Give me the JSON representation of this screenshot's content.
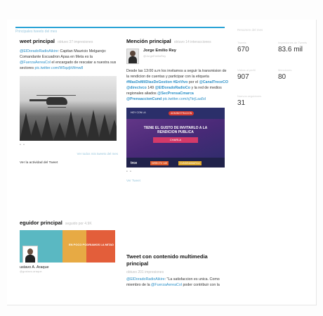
{
  "header": {
    "bar_label": "Principales tweets del mes",
    "accent_color": "#2aa3d6"
  },
  "top_tweet": {
    "title": "weet principal",
    "subtitle": "obtuvo 37 impresiones",
    "text_parts": [
      {
        "t": "@ElDoradoRadioAikire",
        "k": "lnk"
      },
      {
        "t": ": Capitan Mauricio Melgarejo: Comandante Escuadron Apaa en Meta es la ",
        "k": ""
      },
      {
        "t": "@FuerzaAereaCol",
        "k": "lnk"
      },
      {
        "t": " el encargado de rescatar a nuestra sus sectores ",
        "k": ""
      },
      {
        "t": "pic.twitter.com/W5qzjbWmw8",
        "k": "lnk"
      }
    ],
    "dots": "• •",
    "link": "Ver todos mis tweets del mes",
    "view_all": "Ver la actividad del Tweet"
  },
  "top_follower": {
    "title": "eguidor principal",
    "subtitle": "seguido por 4.9K",
    "banner_text": "EN POCO PODRIAMOS LA MITAD",
    "name": "ustavo A. Araque",
    "handle": "@gustavo.araque"
  },
  "top_mention": {
    "title": "Mención principal",
    "subtitle": "obtuvo 14 interacciones",
    "name": "Jorge Emilio Rey",
    "handle": "@JorgeEmilioRey",
    "text_parts": [
      {
        "t": "Desde las 13:00 a.m los invitamos a seguir la transmision de la rendicion de cuentas y participar con la etiqueta ",
        "k": ""
      },
      {
        "t": "#MasDeMilDiasDeGestion",
        "k": "hl"
      },
      {
        "t": " ",
        "k": ""
      },
      {
        "t": "#EnVivo",
        "k": "hl"
      },
      {
        "t": " por el ",
        "k": ""
      },
      {
        "t": "@CanalTreceCO",
        "k": "hl"
      },
      {
        "t": " ",
        "k": ""
      },
      {
        "t": "@directvco",
        "k": "hl"
      },
      {
        "t": " 149 ",
        "k": ""
      },
      {
        "t": "@ElDoradoRadioCo",
        "k": "hl"
      },
      {
        "t": " y la red de medios regionales aliados ",
        "k": ""
      },
      {
        "t": "@SecPrensaCmarca",
        "k": "hl"
      },
      {
        "t": " ",
        "k": ""
      },
      {
        "t": "@PrensaccionCund",
        "k": "hl"
      },
      {
        "t": " ",
        "k": ""
      },
      {
        "t": "pic.twitter.com/q7krjLaa5d",
        "k": "lnk"
      }
    ],
    "poster": {
      "tag": "HOY CON LA",
      "tag2": "ADMINISTRACION",
      "main": "TIENE EL GUSTO DE INVITARLO A LA RENDICION PUBLICA",
      "ribbon": "CHARLA",
      "logo1": "trce",
      "logo2": "DIRECTV 149",
      "logo3": "CUNDINAMARCA"
    },
    "dots": "• •",
    "link": "Ver Tweet"
  },
  "top_media_tweet": {
    "title": "Tweet con contenido multimedia principal",
    "subtitle": "obtuvo 201 impresiones",
    "text_parts": [
      {
        "t": "@ElDoradoRadioAikire",
        "k": "lnk"
      },
      {
        "t": ": \"La satisfaccion es unica. Como miembro de la ",
        "k": ""
      },
      {
        "t": "@FuerzaAereaCol",
        "k": "lnk"
      },
      {
        "t": " poder contribuir con la",
        "k": ""
      }
    ]
  },
  "stats": [
    {
      "label": "Tweets",
      "value": "670"
    },
    {
      "label": "Impresiones de Tweets",
      "value": "83.6 mil"
    },
    {
      "label": "Visitas al perfil",
      "value": "907"
    },
    {
      "label": "Menciones",
      "value": "80"
    },
    {
      "label": "Nuevos seguidores",
      "value": "31"
    }
  ],
  "stats_header": "Resumen del mes"
}
